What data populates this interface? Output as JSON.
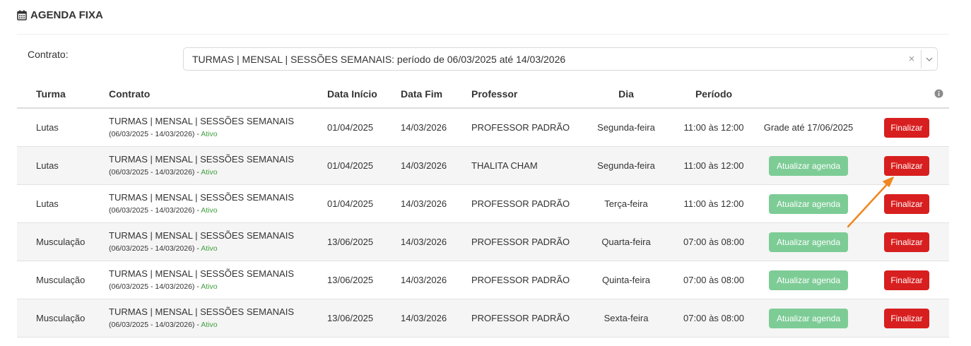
{
  "page": {
    "title": "AGENDA FIXA",
    "title_icon": "calendar-icon"
  },
  "filter": {
    "label": "Contrato:",
    "selected": "TURMAS | MENSAL | SESSÕES SEMANAIS: período de 06/03/2025 até 14/03/2026",
    "clear_symbol": "×"
  },
  "table": {
    "headers": {
      "turma": "Turma",
      "contrato": "Contrato",
      "data_inicio": "Data Início",
      "data_fim": "Data Fim",
      "professor": "Professor",
      "dia": "Dia",
      "periodo": "Período",
      "info_icon": "info-icon"
    },
    "rows": [
      {
        "turma": "Lutas",
        "contrato": "TURMAS | MENSAL | SESSÕES SEMANAIS",
        "contrato_periodo": "(06/03/2025 - 14/03/2026) -",
        "contrato_status": "Ativo",
        "data_inicio": "01/04/2025",
        "data_fim": "14/03/2026",
        "professor": "PROFESSOR PADRÃO",
        "dia": "Segunda-feira",
        "periodo": "11:00 às 12:00",
        "action_type": "text",
        "action_text": "Grade até 17/06/2025",
        "finalize_label": "Finalizar"
      },
      {
        "turma": "Lutas",
        "contrato": "TURMAS | MENSAL | SESSÕES SEMANAIS",
        "contrato_periodo": "(06/03/2025 - 14/03/2026) -",
        "contrato_status": "Ativo",
        "data_inicio": "01/04/2025",
        "data_fim": "14/03/2026",
        "professor": "THALITA CHAM",
        "dia": "Segunda-feira",
        "periodo": "11:00 às 12:00",
        "action_type": "button",
        "action_text": "Atualizar agenda",
        "finalize_label": "Finalizar"
      },
      {
        "turma": "Lutas",
        "contrato": "TURMAS | MENSAL | SESSÕES SEMANAIS",
        "contrato_periodo": "(06/03/2025 - 14/03/2026) -",
        "contrato_status": "Ativo",
        "data_inicio": "01/04/2025",
        "data_fim": "14/03/2026",
        "professor": "PROFESSOR PADRÃO",
        "dia": "Terça-feira",
        "periodo": "11:00 às 12:00",
        "action_type": "button",
        "action_text": "Atualizar agenda",
        "finalize_label": "Finalizar"
      },
      {
        "turma": "Musculação",
        "contrato": "TURMAS | MENSAL | SESSÕES SEMANAIS",
        "contrato_periodo": "(06/03/2025 - 14/03/2026) -",
        "contrato_status": "Ativo",
        "data_inicio": "13/06/2025",
        "data_fim": "14/03/2026",
        "professor": "PROFESSOR PADRÃO",
        "dia": "Quarta-feira",
        "periodo": "07:00 às 08:00",
        "action_type": "button",
        "action_text": "Atualizar agenda",
        "finalize_label": "Finalizar"
      },
      {
        "turma": "Musculação",
        "contrato": "TURMAS | MENSAL | SESSÕES SEMANAIS",
        "contrato_periodo": "(06/03/2025 - 14/03/2026) -",
        "contrato_status": "Ativo",
        "data_inicio": "13/06/2025",
        "data_fim": "14/03/2026",
        "professor": "PROFESSOR PADRÃO",
        "dia": "Quinta-feira",
        "periodo": "07:00 às 08:00",
        "action_type": "button",
        "action_text": "Atualizar agenda",
        "finalize_label": "Finalizar"
      },
      {
        "turma": "Musculação",
        "contrato": "TURMAS | MENSAL | SESSÕES SEMANAIS",
        "contrato_periodo": "(06/03/2025 - 14/03/2026) -",
        "contrato_status": "Ativo",
        "data_inicio": "13/06/2025",
        "data_fim": "14/03/2026",
        "professor": "PROFESSOR PADRÃO",
        "dia": "Sexta-feira",
        "periodo": "07:00 às 08:00",
        "action_type": "button",
        "action_text": "Atualizar agenda",
        "finalize_label": "Finalizar"
      }
    ]
  },
  "annotation": {
    "icon": "arrow-annotation-icon",
    "color": "#f0861e"
  },
  "colors": {
    "finalize": "#d81f1f",
    "update": "#7dcc96",
    "status_active": "#3fa03f"
  }
}
